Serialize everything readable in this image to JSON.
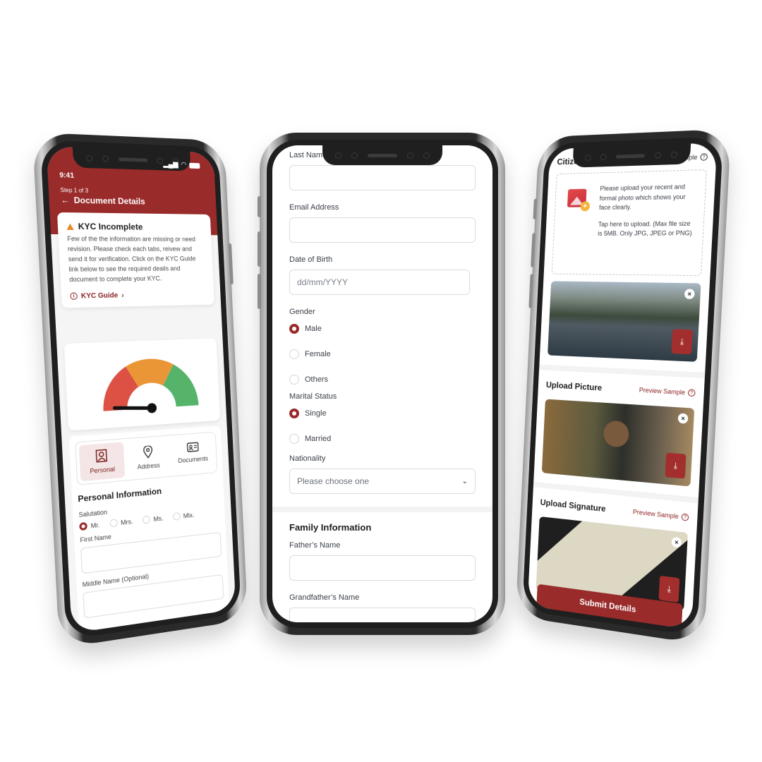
{
  "brand": {
    "primary": "#992b2a",
    "primary_light": "#f4e6e6",
    "warning": "#e58a2c",
    "gauge_red": "#dc5143",
    "gauge_orange": "#eb9636",
    "gauge_green": "#55b46a"
  },
  "left_phone": {
    "status": {
      "time": "9:41",
      "icons": [
        "signal-icon",
        "wifi-icon",
        "battery-icon"
      ]
    },
    "header": {
      "step": "Step 1 of 3",
      "title": "Document Details",
      "back_icon": "arrow-left-icon"
    },
    "kyc_alert": {
      "title": "KYC Incomplete",
      "icon": "warning-icon",
      "message": "Few of the the information are missing or need revision. Please check each tabs, reivew and send it for verification. Click on the KYC Guide link below to see the required deails and document to complete your KYC.",
      "guide_link": "KYC Guide"
    },
    "gauge": {
      "segments": [
        "low",
        "medium",
        "high"
      ],
      "needle_value": 0.02
    },
    "tabs": [
      {
        "label": "Personal",
        "icon": "user-portrait-icon",
        "active": true
      },
      {
        "label": "Address",
        "icon": "location-pin-icon",
        "active": false
      },
      {
        "label": "Documents",
        "icon": "id-card-icon",
        "active": false
      }
    ],
    "personal_info": {
      "title": "Personal Information",
      "salutation_label": "Salutation",
      "salutations": [
        {
          "label": "Mr.",
          "selected": true
        },
        {
          "label": "Mrs.",
          "selected": false
        },
        {
          "label": "Ms.",
          "selected": false
        },
        {
          "label": "Mlx.",
          "selected": false
        }
      ],
      "first_name_label": "First Name",
      "first_name_value": "",
      "middle_name_label": "Middle Name (Optional)",
      "middle_name_value": ""
    }
  },
  "middle_phone": {
    "last_name_label": "Last Name",
    "last_name_value": "",
    "email_label": "Email Address",
    "email_value": "",
    "dob_label": "Date of Birth",
    "dob_placeholder": "dd/mm/YYYY",
    "gender_label": "Gender",
    "genders": [
      {
        "label": "Male",
        "selected": true
      },
      {
        "label": "Female",
        "selected": false
      },
      {
        "label": "Others",
        "selected": false
      }
    ],
    "marital_label": "Marital Status",
    "marital": [
      {
        "label": "Single",
        "selected": true
      },
      {
        "label": "Married",
        "selected": false
      }
    ],
    "nationality_label": "Nationality",
    "nationality_placeholder": "Please choose one",
    "family_title": "Family Information",
    "father_label": "Father’s Name",
    "father_value": "",
    "grandfather_label": "Grandfather’s Name",
    "grandfather_value": ""
  },
  "right_phone": {
    "citizenship": {
      "title": "Citizens",
      "preview": "mple"
    },
    "dropzone": {
      "line1": "Please upload your recent and formal photo which shows your face clearly.",
      "line2": "Tap here to upload. (Max file size is 5MB. Only JPG, JPEG or PNG)"
    },
    "upload_picture": {
      "title": "Upload Picture",
      "preview": "Preview Sample"
    },
    "upload_signature": {
      "title": "Upload Signature",
      "preview": "Preview Sample"
    },
    "submit_label": "Submit Details",
    "remove_glyph": "×",
    "download_glyph": "⤓"
  }
}
